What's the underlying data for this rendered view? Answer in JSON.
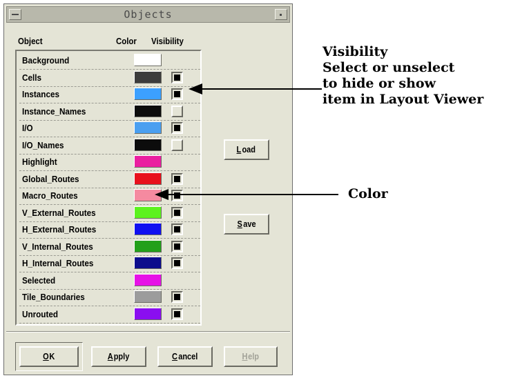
{
  "window": {
    "title": "Objects",
    "menu_icon": "window-menu-icon",
    "maximize_icon": "maximize-icon"
  },
  "columns": {
    "object": "Object",
    "color": "Color",
    "visibility": "Visibility"
  },
  "objects": [
    {
      "name": "Background",
      "color": "#ffffff",
      "visibility": null
    },
    {
      "name": "Cells",
      "color": "#3c3c3c",
      "visibility": true
    },
    {
      "name": "Instances",
      "color": "#3ca0ff",
      "visibility": true
    },
    {
      "name": "Instance_Names",
      "color": "#0c0c0c",
      "visibility": false
    },
    {
      "name": "I/O",
      "color": "#4a9ff0",
      "visibility": true
    },
    {
      "name": "I/O_Names",
      "color": "#0c0c0c",
      "visibility": false
    },
    {
      "name": "Highlight",
      "color": "#ea1fa0",
      "visibility": null
    },
    {
      "name": "Global_Routes",
      "color": "#e8101c",
      "visibility": true
    },
    {
      "name": "Macro_Routes",
      "color": "#f58aa0",
      "visibility": true
    },
    {
      "name": "V_External_Routes",
      "color": "#5cf21e",
      "visibility": true
    },
    {
      "name": "H_External_Routes",
      "color": "#1010f0",
      "visibility": true
    },
    {
      "name": "V_Internal_Routes",
      "color": "#22a01a",
      "visibility": true
    },
    {
      "name": "H_Internal_Routes",
      "color": "#0c0c8c",
      "visibility": true
    },
    {
      "name": "Selected",
      "color": "#e612e6",
      "visibility": null
    },
    {
      "name": "Tile_Boundaries",
      "color": "#9c9c9c",
      "visibility": true
    },
    {
      "name": "Unrouted",
      "color": "#8a0ef0",
      "visibility": true
    }
  ],
  "side_buttons": {
    "load": {
      "mnemonic": "L",
      "rest": "oad"
    },
    "save": {
      "mnemonic": "S",
      "rest": "ave"
    }
  },
  "bottom_buttons": {
    "ok": {
      "mnemonic": "O",
      "rest": "K"
    },
    "apply": {
      "mnemonic": "A",
      "rest": "pply"
    },
    "cancel": {
      "mnemonic": "C",
      "rest": "ancel"
    },
    "help": {
      "mnemonic": "H",
      "rest": "elp"
    }
  },
  "annotations": {
    "visibility_lines": [
      "Visibility",
      "Select or unselect",
      "to hide or show",
      "item in Layout Viewer"
    ],
    "color": "Color"
  }
}
